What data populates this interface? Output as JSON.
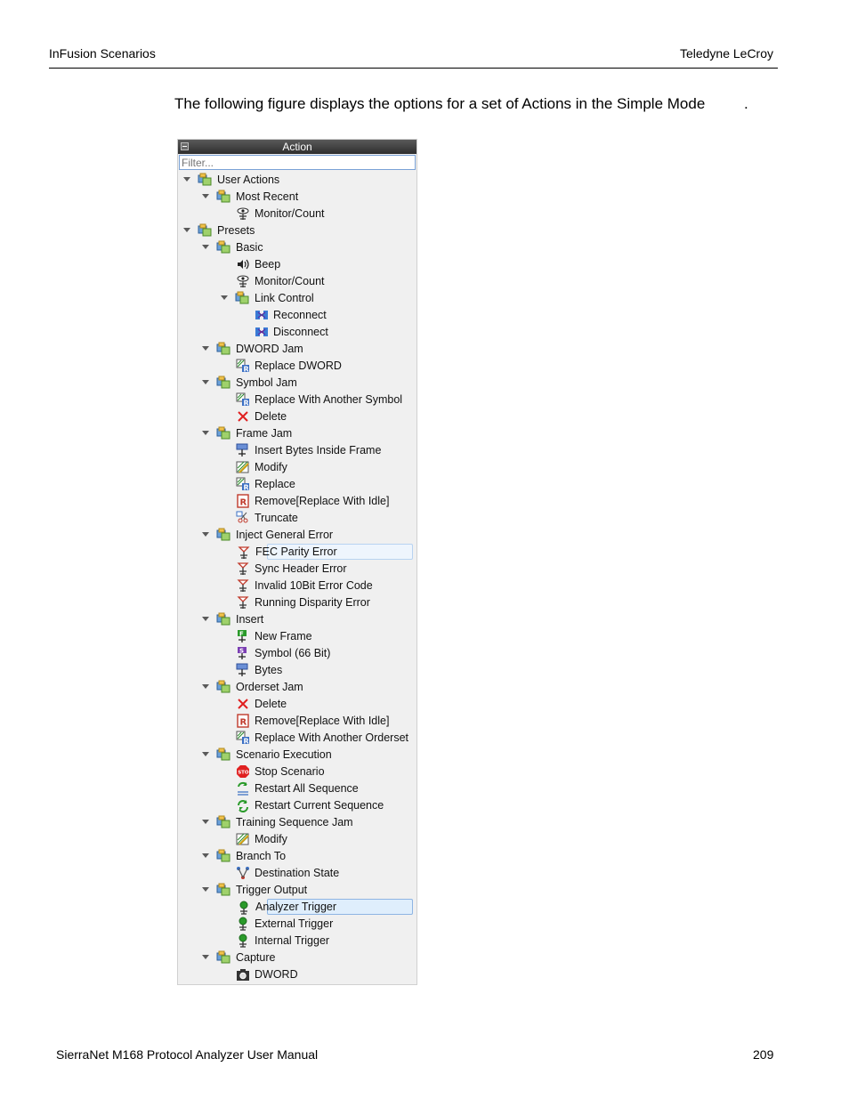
{
  "header": {
    "left": "InFusion Scenarios",
    "right": "Teledyne LeCroy"
  },
  "intro": {
    "text": "The following figure displays the options for a set of Actions in the Simple Mode",
    "trailing": "."
  },
  "footer": {
    "left": "SierraNet M168 Protocol Analyzer User Manual",
    "page": "209"
  },
  "panel": {
    "title": "Action",
    "filter_placeholder": "Filter...",
    "rows": [
      {
        "label": "User Actions",
        "level": 0,
        "expand": true,
        "icon": "folder-icon"
      },
      {
        "label": "Most Recent",
        "level": 1,
        "expand": true,
        "icon": "folder-icon"
      },
      {
        "label": "Monitor/Count",
        "level": 2,
        "expand": false,
        "icon": "eye-icon"
      },
      {
        "label": "Presets",
        "level": 0,
        "expand": true,
        "icon": "folder-icon"
      },
      {
        "label": "Basic",
        "level": 1,
        "expand": true,
        "icon": "folder-icon"
      },
      {
        "label": "Beep",
        "level": 2,
        "expand": false,
        "icon": "speaker-icon"
      },
      {
        "label": "Monitor/Count",
        "level": 2,
        "expand": false,
        "icon": "eye-icon"
      },
      {
        "label": "Link Control",
        "level": 2,
        "expand": true,
        "icon": "folder-icon"
      },
      {
        "label": "Reconnect",
        "level": 3,
        "expand": false,
        "icon": "reconnect-icon"
      },
      {
        "label": "Disconnect",
        "level": 3,
        "expand": false,
        "icon": "disconnect-icon"
      },
      {
        "label": "DWORD Jam",
        "level": 1,
        "expand": true,
        "icon": "folder-icon"
      },
      {
        "label": "Replace DWORD",
        "level": 2,
        "expand": false,
        "icon": "replace-icon"
      },
      {
        "label": "Symbol Jam",
        "level": 1,
        "expand": true,
        "icon": "folder-icon"
      },
      {
        "label": "Replace With Another Symbol",
        "level": 2,
        "expand": false,
        "icon": "replace-icon"
      },
      {
        "label": "Delete",
        "level": 2,
        "expand": false,
        "icon": "delete-icon"
      },
      {
        "label": "Frame Jam",
        "level": 1,
        "expand": true,
        "icon": "folder-icon"
      },
      {
        "label": "Insert Bytes Inside Frame",
        "level": 2,
        "expand": false,
        "icon": "insert-bytes-icon"
      },
      {
        "label": "Modify",
        "level": 2,
        "expand": false,
        "icon": "modify-icon"
      },
      {
        "label": "Replace",
        "level": 2,
        "expand": false,
        "icon": "replace-icon"
      },
      {
        "label": "Remove[Replace With Idle]",
        "level": 2,
        "expand": false,
        "icon": "remove-icon"
      },
      {
        "label": "Truncate",
        "level": 2,
        "expand": false,
        "icon": "truncate-icon"
      },
      {
        "label": "Inject General Error",
        "level": 1,
        "expand": true,
        "icon": "folder-icon"
      },
      {
        "label": "FEC Parity Error",
        "level": 2,
        "expand": false,
        "icon": "error-icon",
        "state": "hover"
      },
      {
        "label": "Sync Header Error",
        "level": 2,
        "expand": false,
        "icon": "error-icon"
      },
      {
        "label": "Invalid 10Bit Error Code",
        "level": 2,
        "expand": false,
        "icon": "error-icon"
      },
      {
        "label": "Running Disparity Error",
        "level": 2,
        "expand": false,
        "icon": "error-icon"
      },
      {
        "label": "Insert",
        "level": 1,
        "expand": true,
        "icon": "folder-icon"
      },
      {
        "label": "New Frame",
        "level": 2,
        "expand": false,
        "icon": "new-frame-icon"
      },
      {
        "label": "Symbol (66 Bit)",
        "level": 2,
        "expand": false,
        "icon": "symbol-icon"
      },
      {
        "label": "Bytes",
        "level": 2,
        "expand": false,
        "icon": "insert-bytes-icon"
      },
      {
        "label": "Orderset Jam",
        "level": 1,
        "expand": true,
        "icon": "folder-icon"
      },
      {
        "label": "Delete",
        "level": 2,
        "expand": false,
        "icon": "delete-icon"
      },
      {
        "label": "Remove[Replace With Idle]",
        "level": 2,
        "expand": false,
        "icon": "remove-icon"
      },
      {
        "label": "Replace With Another Orderset",
        "level": 2,
        "expand": false,
        "icon": "replace-icon"
      },
      {
        "label": "Scenario Execution",
        "level": 1,
        "expand": true,
        "icon": "folder-icon"
      },
      {
        "label": "Stop Scenario",
        "level": 2,
        "expand": false,
        "icon": "stop-icon"
      },
      {
        "label": "Restart All Sequence",
        "level": 2,
        "expand": false,
        "icon": "restart-all-icon"
      },
      {
        "label": "Restart Current Sequence",
        "level": 2,
        "expand": false,
        "icon": "restart-icon"
      },
      {
        "label": "Training Sequence Jam",
        "level": 1,
        "expand": true,
        "icon": "folder-icon"
      },
      {
        "label": "Modify",
        "level": 2,
        "expand": false,
        "icon": "modify-icon"
      },
      {
        "label": "Branch To",
        "level": 1,
        "expand": true,
        "icon": "folder-icon"
      },
      {
        "label": "Destination State",
        "level": 2,
        "expand": false,
        "icon": "branch-icon"
      },
      {
        "label": "Trigger Output",
        "level": 1,
        "expand": true,
        "icon": "folder-icon"
      },
      {
        "label": "Analyzer Trigger",
        "level": 2,
        "expand": false,
        "icon": "trigger-icon",
        "state": "selected"
      },
      {
        "label": "External Trigger",
        "level": 2,
        "expand": false,
        "icon": "trigger-icon"
      },
      {
        "label": "Internal Trigger",
        "level": 2,
        "expand": false,
        "icon": "trigger-icon"
      },
      {
        "label": "Capture",
        "level": 1,
        "expand": true,
        "icon": "folder-icon"
      },
      {
        "label": "DWORD",
        "level": 2,
        "expand": false,
        "icon": "capture-icon"
      }
    ]
  }
}
